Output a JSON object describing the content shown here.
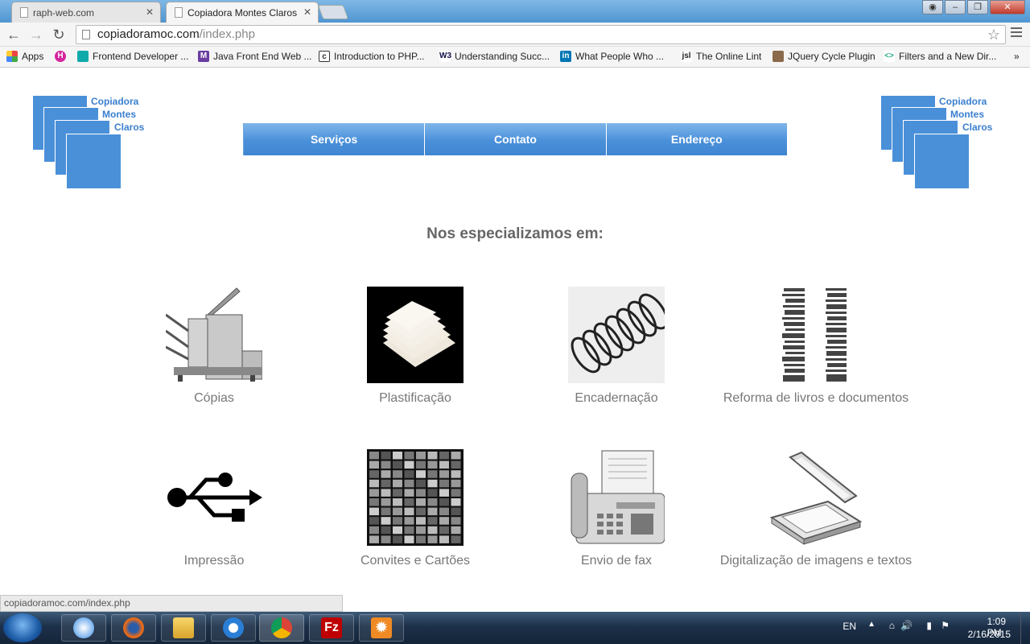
{
  "browser": {
    "tabs": [
      {
        "title": "raph-web.com",
        "active": false
      },
      {
        "title": "Copiadora Montes Claros",
        "active": true
      }
    ],
    "url_domain": "copiadoramoc.com",
    "url_path": "/index.php",
    "bookmarks": [
      {
        "label": "Apps",
        "icon": "apps-icon"
      },
      {
        "label": "",
        "icon": "treehouse-icon"
      },
      {
        "label": "Frontend Developer ...",
        "icon": "treehouse-leaf-icon"
      },
      {
        "label": "Java Front End Web ...",
        "icon": "m-icon"
      },
      {
        "label": "Introduction to PHP...",
        "icon": "c-icon"
      },
      {
        "label": "Understanding Succ...",
        "icon": "w3-icon"
      },
      {
        "label": "What People Who ...",
        "icon": "linkedin-icon"
      },
      {
        "label": "The Online Lint",
        "icon": "jsl-icon"
      },
      {
        "label": "JQuery Cycle Plugin",
        "icon": "avatar-icon"
      },
      {
        "label": "Filters and a New Dir...",
        "icon": "code-icon"
      }
    ],
    "bookmarks_overflow": "»",
    "status_url": "copiadoramoc.com/index.php"
  },
  "site": {
    "logo_lines": [
      "Copiadora",
      "Montes",
      "Claros"
    ],
    "nav": [
      "Serviços",
      "Contato",
      "Endereço"
    ],
    "heading": "Nos especializamos em:",
    "services": [
      {
        "label": "Cópias",
        "icon": "copier-icon"
      },
      {
        "label": "Plastificação",
        "icon": "laminate-sheets-icon"
      },
      {
        "label": "Encadernação",
        "icon": "spiral-binding-icon"
      },
      {
        "label": "Reforma de livros e documentos",
        "icon": "book-stacks-icon"
      },
      {
        "label": "Impressão",
        "icon": "usb-icon"
      },
      {
        "label": "Convites e Cartões",
        "icon": "cards-grid-icon"
      },
      {
        "label": "Envio de fax",
        "icon": "fax-icon"
      },
      {
        "label": "Digitalização de imagens e textos",
        "icon": "scanner-icon"
      }
    ]
  },
  "taskbar": {
    "apps": [
      "safari-icon",
      "firefox-icon",
      "explorer-icon",
      "ie-icon",
      "chrome-icon",
      "filezilla-icon",
      "settings-icon"
    ],
    "lang": "EN",
    "time": "1:09 PM",
    "date": "2/16/2015"
  },
  "colors": {
    "accent": "#4a90d9",
    "text_gray": "#777777"
  }
}
